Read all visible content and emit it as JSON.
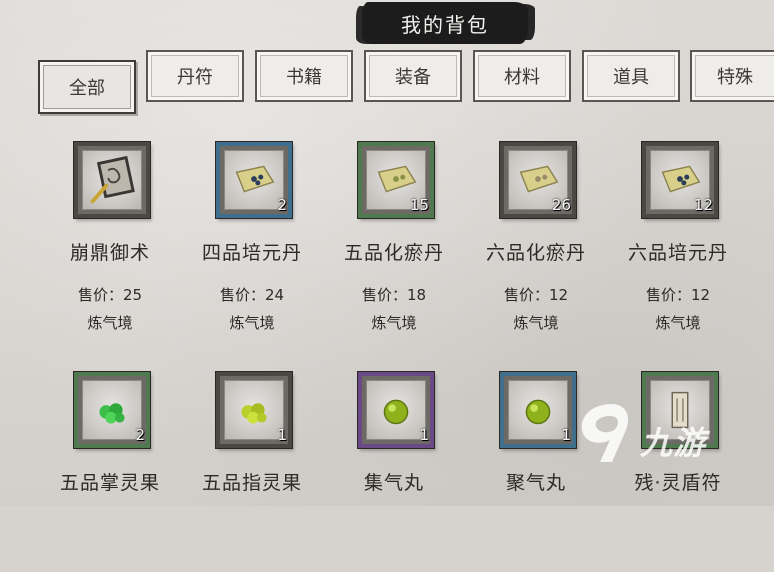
{
  "title": "我的背包",
  "tabs": [
    {
      "label": "全部",
      "active": true
    },
    {
      "label": "丹符",
      "active": false
    },
    {
      "label": "书籍",
      "active": false
    },
    {
      "label": "装备",
      "active": false
    },
    {
      "label": "材料",
      "active": false
    },
    {
      "label": "道具",
      "active": false
    },
    {
      "label": "特殊",
      "active": false
    }
  ],
  "items_row1": [
    {
      "name": "崩鼎御术",
      "price": "售价：25",
      "realm": "炼气境",
      "count": "",
      "icon": "scroll-book-icon",
      "rarity": "gray"
    },
    {
      "name": "四品培元丹",
      "price": "售价：24",
      "realm": "炼气境",
      "count": "2",
      "icon": "pill-packet-icon",
      "rarity": "blue"
    },
    {
      "name": "五品化瘀丹",
      "price": "售价：18",
      "realm": "炼气境",
      "count": "15",
      "icon": "pill-packet-icon",
      "rarity": "green"
    },
    {
      "name": "六品化瘀丹",
      "price": "售价：12",
      "realm": "炼气境",
      "count": "26",
      "icon": "pill-packet-icon",
      "rarity": "gray"
    },
    {
      "name": "六品培元丹",
      "price": "售价：12",
      "realm": "炼气境",
      "count": "12",
      "icon": "pill-packet-icon",
      "rarity": "gray"
    }
  ],
  "items_row2": [
    {
      "name": "五品掌灵果",
      "count": "2",
      "icon": "green-fruit-icon",
      "rarity": "green"
    },
    {
      "name": "五品指灵果",
      "count": "1",
      "icon": "yellow-fruit-icon",
      "rarity": "gray"
    },
    {
      "name": "集气丸",
      "count": "1",
      "icon": "pill-orb-icon",
      "rarity": "purple"
    },
    {
      "name": "聚气丸",
      "count": "1",
      "icon": "pill-orb-icon",
      "rarity": "blue"
    },
    {
      "name": "残·灵盾符",
      "count": "",
      "icon": "talisman-icon",
      "rarity": "green"
    }
  ],
  "watermark": {
    "text": "九游"
  },
  "colors": {
    "blue_frame": "#3f6f8c",
    "green_frame": "#4e7a4e",
    "purple_frame": "#6a4a86",
    "gray_frame": "#4b4844"
  }
}
